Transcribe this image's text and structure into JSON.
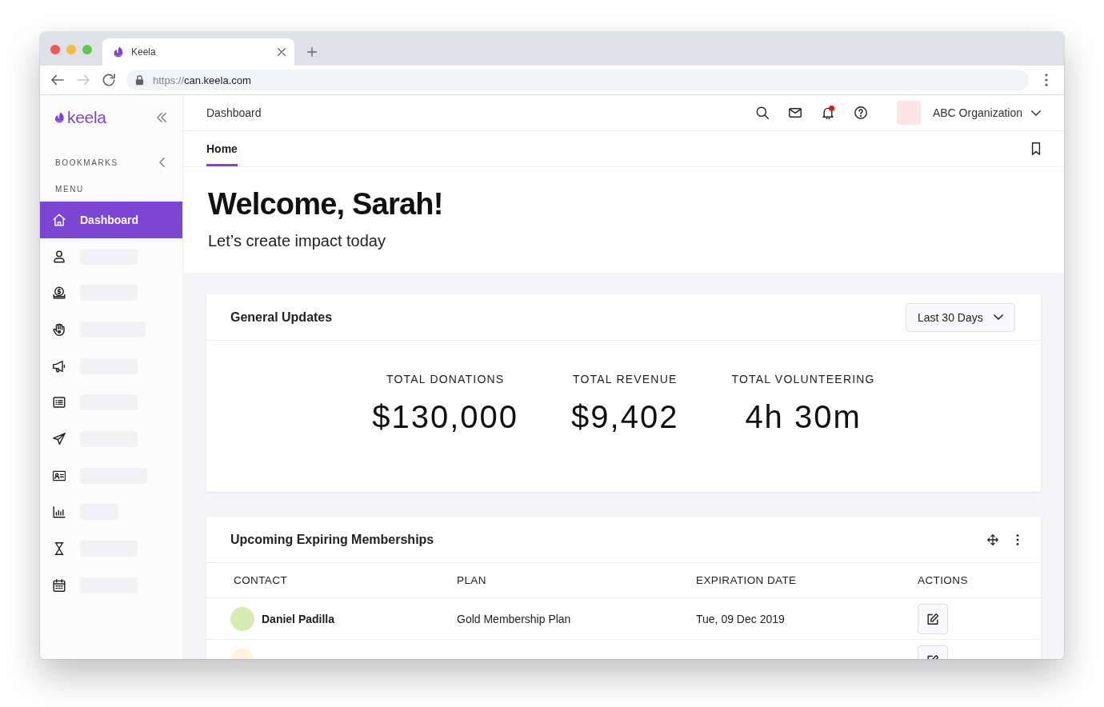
{
  "browser": {
    "tab": {
      "title": "Keela"
    },
    "nav_buttons": [
      {
        "disabled": false
      },
      {
        "disabled": true
      },
      {
        "disabled": false
      }
    ],
    "url": {
      "scheme": "https://",
      "host": "can.keela.com"
    }
  },
  "sidebar": {
    "logo": "keela",
    "bookmarks_label": "BOOKMARKS",
    "menu_label": "MENU",
    "items": [
      {
        "label": "Dashboard",
        "selected": true
      },
      {
        "selected": false
      },
      {
        "selected": false
      },
      {
        "selected": false
      },
      {
        "selected": false
      },
      {
        "selected": false
      },
      {
        "selected": false
      },
      {
        "selected": false
      },
      {
        "selected": false
      },
      {
        "selected": false
      },
      {
        "selected": false
      }
    ]
  },
  "header": {
    "breadcrumb": "Dashboard",
    "notifications_unread": true,
    "organization": "ABC Organization"
  },
  "tabs": [
    {
      "label": "Home",
      "selected": true
    }
  ],
  "welcome": {
    "title": "Welcome, Sarah!",
    "subtitle": "Let’s create impact today"
  },
  "general_updates": {
    "title": "General Updates",
    "range": "Last 30 Days",
    "stats": [
      {
        "label": "TOTAL DONATIONS",
        "value": "$130,000"
      },
      {
        "label": "TOTAL REVENUE",
        "value": "$9,402"
      },
      {
        "label": "TOTAL VOLUNTEERING",
        "value": "4h 30m"
      }
    ]
  },
  "memberships": {
    "title": "Upcoming Expiring Memberships",
    "columns": [
      "CONTACT",
      "PLAN",
      "EXPIRATION DATE",
      "ACTIONS"
    ],
    "rows": [
      {
        "contact": "Daniel Padilla",
        "color": "#d5ebb0",
        "plan": "Gold Membership Plan",
        "expiration_date": "Tue, 09 Dec 2019"
      },
      {
        "color": "#fcf5dc"
      }
    ]
  }
}
